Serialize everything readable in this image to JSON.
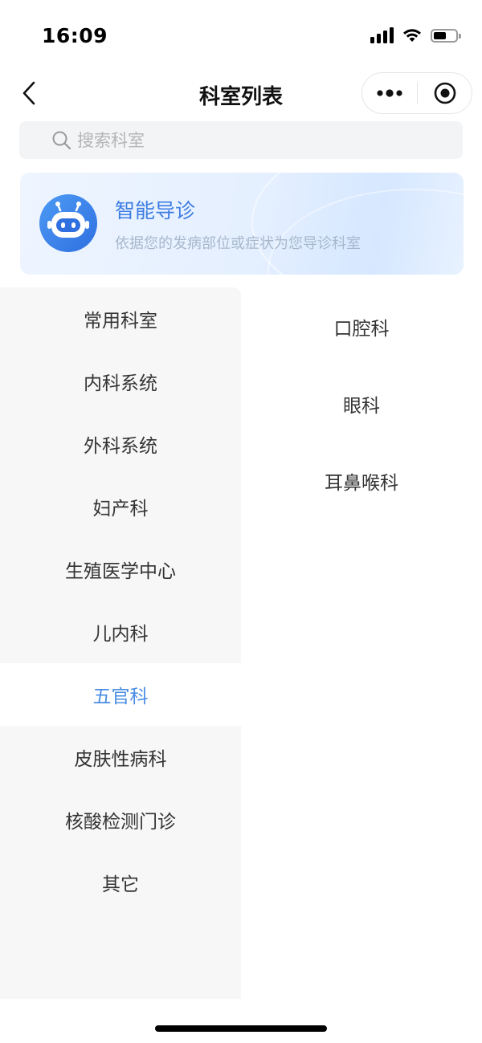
{
  "status_bar": {
    "time": "16:09"
  },
  "nav": {
    "title": "科室列表",
    "back_icon": "chevron-left-icon",
    "more_icon": "more-dots-icon",
    "close_icon": "target-close-icon"
  },
  "search": {
    "placeholder": "搜索科室",
    "value": ""
  },
  "guide": {
    "title": "智能导诊",
    "subtitle": "依据您的发病部位或症状为您导诊科室",
    "icon": "robot-icon"
  },
  "categories": [
    {
      "label": "常用科室",
      "active": false
    },
    {
      "label": "内科系统",
      "active": false
    },
    {
      "label": "外科系统",
      "active": false
    },
    {
      "label": "妇产科",
      "active": false
    },
    {
      "label": "生殖医学中心",
      "active": false
    },
    {
      "label": "儿内科",
      "active": false
    },
    {
      "label": "五官科",
      "active": true
    },
    {
      "label": "皮肤性病科",
      "active": false
    },
    {
      "label": "核酸检测门诊",
      "active": false
    },
    {
      "label": "其它",
      "active": false
    }
  ],
  "departments": [
    {
      "label": "口腔科"
    },
    {
      "label": "眼科"
    },
    {
      "label": "耳鼻喉科"
    }
  ],
  "colors": {
    "accent": "#4a8de3",
    "banner_title": "#3c7ce2",
    "sidebar_bg": "#f7f7f7"
  }
}
